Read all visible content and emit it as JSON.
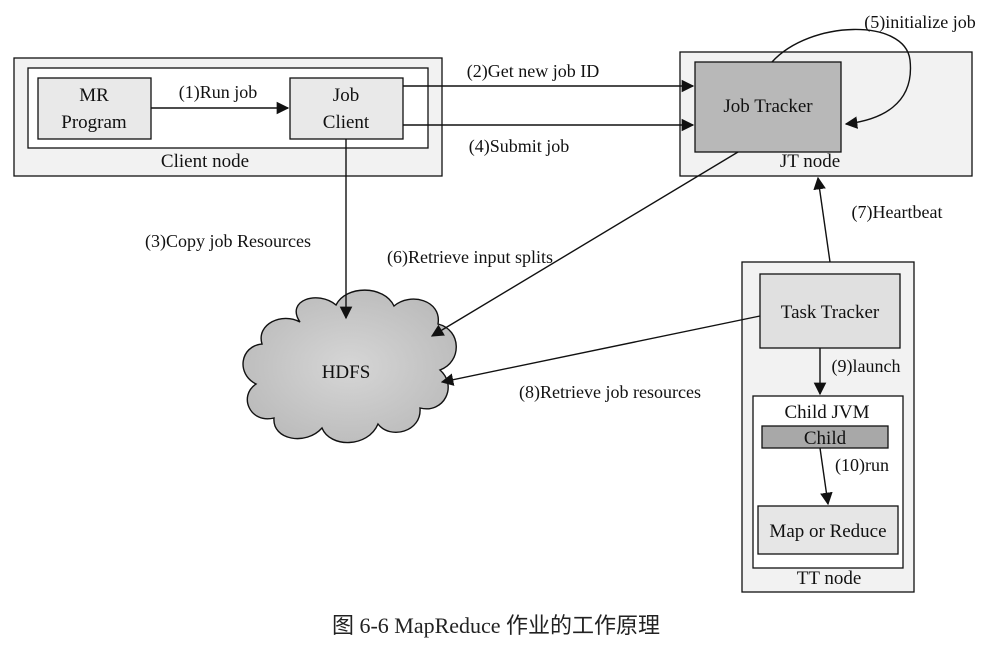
{
  "diagram": {
    "client_node": {
      "label": "Client node",
      "mr_program": {
        "line1": "MR",
        "line2": "Program"
      },
      "job_client": {
        "line1": "Job",
        "line2": "Client"
      }
    },
    "jt_node": {
      "label": "JT node",
      "job_tracker": "Job Tracker"
    },
    "tt_node": {
      "label": "TT node",
      "task_tracker": "Task Tracker",
      "child_jvm": "Child JVM",
      "child": "Child",
      "map_or_reduce": "Map or Reduce"
    },
    "hdfs": "HDFS",
    "edges": {
      "run_job": "(1)Run job",
      "get_new_job_id": "(2)Get new job ID",
      "copy_job_resources": "(3)Copy job Resources",
      "submit_job": "(4)Submit job",
      "initialize_job": "(5)initialize job",
      "retrieve_input_splits": "(6)Retrieve input splits",
      "heartbeat": "(7)Heartbeat",
      "retrieve_job_resources": "(8)Retrieve job resources",
      "launch": "(9)launch",
      "run": "(10)run"
    },
    "caption": "图 6-6   MapReduce 作业的工作原理",
    "colors": {
      "outer_box_fill": "#f2f2f2",
      "light_box_fill": "#e9e9e9",
      "job_tracker_fill": "#b8b8b8",
      "child_fill": "#a8a8a8",
      "hdfs_fill": "#c8c8c8",
      "stroke": "#111111"
    }
  }
}
